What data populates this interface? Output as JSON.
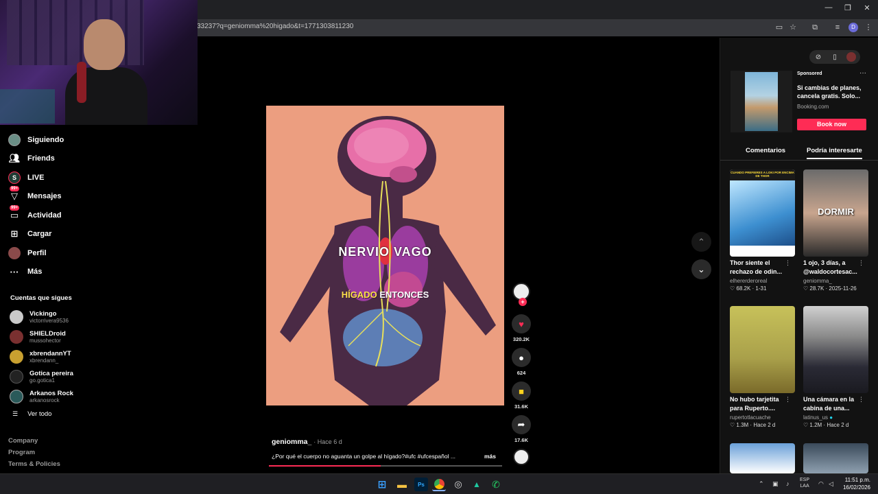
{
  "browser": {
    "url": "33237?q=geniomma%20higado&t=1771303811230",
    "profile_initial": "D"
  },
  "sidebar": {
    "items": [
      {
        "label": "Siguiendo",
        "icon": "following-avatar-icon"
      },
      {
        "label": "Friends",
        "icon": "friends-icon"
      },
      {
        "label": "LIVE",
        "icon": "live-icon"
      },
      {
        "label": "Mensajes",
        "icon": "messages-icon",
        "badge": "99+"
      },
      {
        "label": "Actividad",
        "icon": "activity-icon",
        "badge": "99+"
      },
      {
        "label": "Cargar",
        "icon": "upload-icon"
      },
      {
        "label": "Perfil",
        "icon": "profile-avatar-icon"
      },
      {
        "label": "Más",
        "icon": "more-icon"
      }
    ],
    "following_title": "Cuentas que sigues",
    "following": [
      {
        "name": "Vickingo",
        "user": "victorrivera9536"
      },
      {
        "name": "SHIELDroid",
        "user": "mussohector"
      },
      {
        "name": "xbrendannYT",
        "user": "xbrendann_"
      },
      {
        "name": "Gotica pereira",
        "user": "go.gotica1"
      },
      {
        "name": "Arkanos Rock",
        "user": "arkanosrock"
      }
    ],
    "see_all": "Ver todo",
    "footer": [
      "Company",
      "Program",
      "Terms & Policies"
    ]
  },
  "video": {
    "caption_main": "NERVIO VAGO",
    "caption_sub_a": "HÍGADO",
    "caption_sub_b": "ENTONCES",
    "author": "geniomma_",
    "time": "· Hace 6 d",
    "description": "¿Por qué el cuerpo no aguanta un golpe al hígado?#ufc #ufcespañol ...",
    "more": "más",
    "progress": 0.48,
    "likes": "320.2K",
    "comments": "624",
    "saves": "31.6K",
    "shares": "17.6K"
  },
  "right_panel": {
    "ad": {
      "sponsored": "Sponsored",
      "text": "Si cambias de planes, cancela gratis. Solo...",
      "domain": "Booking.com",
      "button": "Book now"
    },
    "tabs": [
      "Comentarios",
      "Podría interesarte"
    ],
    "cards": [
      {
        "title": "Thor siente el rechazo de odin...",
        "user": "elhererderoreal",
        "likes": "68.2K",
        "date": "1-31",
        "overlay_top": "CUANDO PREFIERES A LOKI POR ENCIMA DE THOR"
      },
      {
        "title": "1 ojo, 3 días, a @waldocortesac...",
        "user": "geniomma_",
        "likes": "28.7K",
        "date": "2025-11-26",
        "overlay": "DORMIR"
      },
      {
        "title": "No hubo tarjetita para Ruperto....",
        "user": "rupertotlacuache",
        "likes": "1.3M",
        "date": "Hace 2 d"
      },
      {
        "title": "Una cámara en la cabina de una...",
        "user": "latinus_us",
        "likes": "1.2M",
        "date": "Hace 2 d"
      }
    ]
  },
  "taskbar": {
    "lang": "ESP",
    "lang2": "LAA",
    "time": "11:51 p.m.",
    "date": "16/02/2026"
  },
  "colors": {
    "accent": "#fe2c55",
    "video_bg": "#ec9e80"
  }
}
